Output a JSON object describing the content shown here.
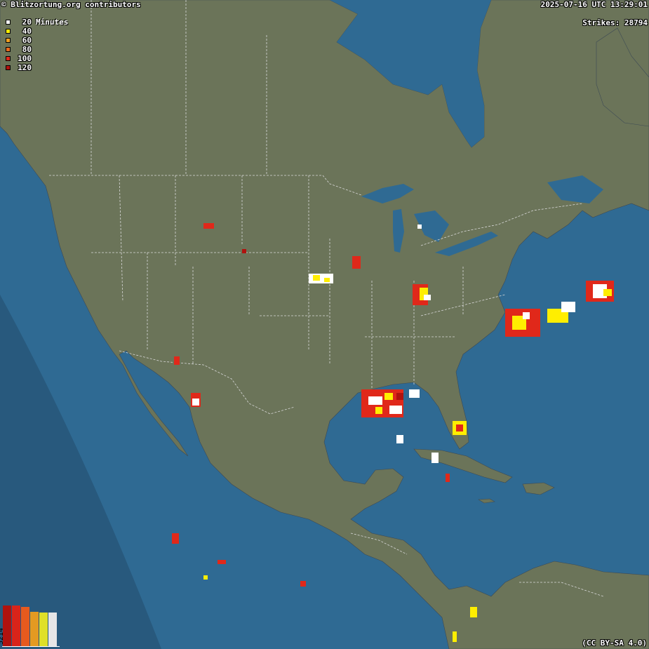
{
  "header": {
    "credit": "© Blitzortung.org contributors",
    "timestamp": "2025-07-16 UTC 13:29:01",
    "strikes_label": "Strikes: 28794"
  },
  "legend": {
    "unit": "Minutes",
    "items": [
      {
        "label": "20",
        "color": "#ffffff"
      },
      {
        "label": "40",
        "color": "#ffee00"
      },
      {
        "label": "60",
        "color": "#f2a020"
      },
      {
        "label": "80",
        "color": "#ea6a1e"
      },
      {
        "label": "100",
        "color": "#e0281a"
      },
      {
        "label": "120",
        "color": "#b0120e"
      }
    ]
  },
  "histogram": {
    "count": "5214",
    "bars": [
      {
        "color": "#b0120e",
        "value": 1.0
      },
      {
        "color": "#d9241a",
        "value": 1.0
      },
      {
        "color": "#e65a1e",
        "value": 0.97
      },
      {
        "color": "#e39a22",
        "value": 0.85
      },
      {
        "color": "#dfe028",
        "value": 0.82
      },
      {
        "color": "#e6e6e6",
        "value": 0.82
      }
    ]
  },
  "license": "(CC BY-SA 4.0)",
  "map": {
    "ocean_color": "#2f6a93",
    "land_color": "#6b7459",
    "night_shade_color": "#28597d",
    "border_color": "#d8d8d8"
  }
}
